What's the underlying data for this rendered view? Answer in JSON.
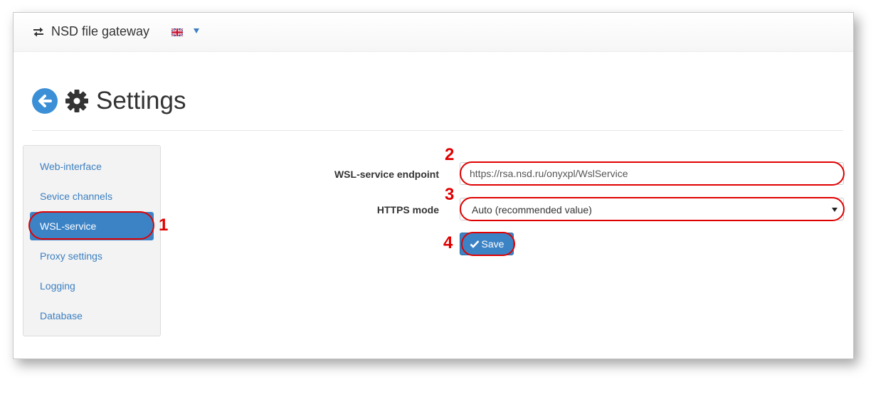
{
  "header": {
    "brand_icon": "exchange-arrows-icon",
    "brand": "NSD file gateway",
    "language_flag": "uk-flag-icon",
    "language_caret": "caret-down-icon"
  },
  "page": {
    "back_icon": "arrow-left-circle-icon",
    "title_icon": "gear-icon",
    "title": "Settings"
  },
  "sidebar": {
    "items": [
      {
        "label": "Web-interface",
        "active": false
      },
      {
        "label": "Sevice channels",
        "active": false
      },
      {
        "label": "WSL-service",
        "active": true
      },
      {
        "label": "Proxy settings",
        "active": false
      },
      {
        "label": "Logging",
        "active": false
      },
      {
        "label": "Database",
        "active": false
      }
    ]
  },
  "form": {
    "endpoint_label": "WSL-service endpoint",
    "endpoint_value": "https://rsa.nsd.ru/onyxpl/WslService",
    "https_mode_label": "HTTPS mode",
    "https_mode_value": "Auto (recommended value)",
    "save_label": "Save"
  },
  "annotations": [
    "1",
    "2",
    "3",
    "4"
  ],
  "colors": {
    "accent": "#3c83c6",
    "link": "#3c7fc1",
    "annotation": "#e00000"
  }
}
